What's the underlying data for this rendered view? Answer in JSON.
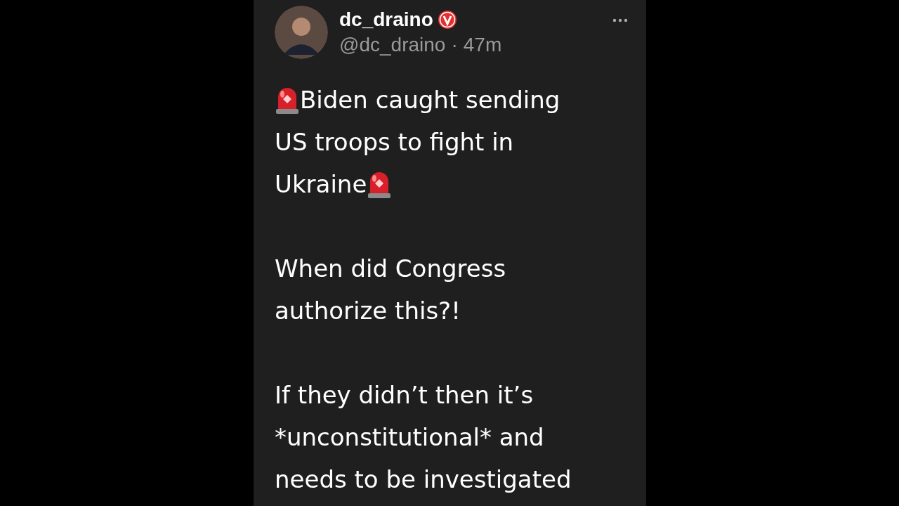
{
  "post": {
    "author": {
      "name": "dc_draino",
      "verified": true,
      "handle": "@dc_draino",
      "separator": "·",
      "time": "47m"
    },
    "paragraphs": [
      {
        "kind": "alert",
        "lines": [
          "Biden caught sending",
          "US troops to fight in",
          "Ukraine"
        ]
      },
      {
        "kind": "plain",
        "lines": [
          "When did Congress",
          "authorize this?!"
        ]
      },
      {
        "kind": "plain",
        "lines": [
          "If they didn’t then it’s",
          "*unconstitutional* and",
          "needs to be investigated"
        ]
      }
    ]
  }
}
